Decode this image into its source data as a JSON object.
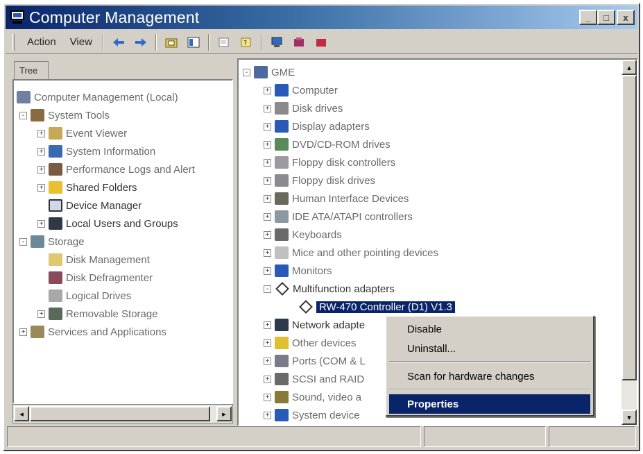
{
  "window": {
    "title": "Computer Management"
  },
  "title_buttons": {
    "minimize": "_",
    "maximize": "□",
    "close": "x"
  },
  "toolbar": {
    "menus": [
      "Action",
      "View"
    ],
    "icons": [
      "back-arrow-icon",
      "forward-arrow-icon",
      "up-folder-icon",
      "show-tree-icon",
      "properties-icon",
      "help-icon",
      "computer-icon",
      "scan-icon",
      "uninstall-icon"
    ]
  },
  "left_pane": {
    "tab_label": "Tree",
    "nodes": [
      {
        "label": "Computer Management (Local)",
        "level": 0,
        "expander": "",
        "dim": true
      },
      {
        "label": "System Tools",
        "level": 1,
        "expander": "-",
        "dim": true
      },
      {
        "label": "Event Viewer",
        "level": 2,
        "expander": "+",
        "dim": true
      },
      {
        "label": "System Information",
        "level": 2,
        "expander": "+",
        "dim": true
      },
      {
        "label": "Performance Logs and Alert",
        "level": 2,
        "expander": "+",
        "dim": true
      },
      {
        "label": "Shared Folders",
        "level": 2,
        "expander": "+",
        "dim": false
      },
      {
        "label": "Device Manager",
        "level": 2,
        "expander": "",
        "dim": false
      },
      {
        "label": "Local Users and Groups",
        "level": 2,
        "expander": "+",
        "dim": false
      },
      {
        "label": "Storage",
        "level": 1,
        "expander": "-",
        "dim": true
      },
      {
        "label": "Disk Management",
        "level": 2,
        "expander": "",
        "dim": true
      },
      {
        "label": "Disk Defragmenter",
        "level": 2,
        "expander": "",
        "dim": true
      },
      {
        "label": "Logical Drives",
        "level": 2,
        "expander": "",
        "dim": true
      },
      {
        "label": "Removable Storage",
        "level": 2,
        "expander": "+",
        "dim": true
      },
      {
        "label": "Services and Applications",
        "level": 1,
        "expander": "+",
        "dim": true
      }
    ]
  },
  "right_pane": {
    "root": "GME",
    "devices": [
      {
        "label": "Computer",
        "expander": "+",
        "dim": true
      },
      {
        "label": "Disk drives",
        "expander": "+",
        "dim": true
      },
      {
        "label": "Display adapters",
        "expander": "+",
        "dim": true
      },
      {
        "label": "DVD/CD-ROM drives",
        "expander": "+",
        "dim": true
      },
      {
        "label": "Floppy disk controllers",
        "expander": "+",
        "dim": true
      },
      {
        "label": "Floppy disk drives",
        "expander": "+",
        "dim": true
      },
      {
        "label": "Human Interface Devices",
        "expander": "+",
        "dim": true
      },
      {
        "label": "IDE ATA/ATAPI controllers",
        "expander": "+",
        "dim": true
      },
      {
        "label": "Keyboards",
        "expander": "+",
        "dim": true
      },
      {
        "label": "Mice and other pointing devices",
        "expander": "+",
        "dim": true
      },
      {
        "label": "Monitors",
        "expander": "+",
        "dim": true
      },
      {
        "label": "Multifunction adapters",
        "expander": "-",
        "dim": false
      },
      {
        "label": "Network adapte",
        "expander": "+",
        "dim": false
      },
      {
        "label": "Other devices",
        "expander": "+",
        "dim": true
      },
      {
        "label": "Ports (COM & L",
        "expander": "+",
        "dim": true
      },
      {
        "label": "SCSI and RAID",
        "expander": "+",
        "dim": true
      },
      {
        "label": "Sound, video a",
        "expander": "+",
        "dim": true
      },
      {
        "label": "System device",
        "expander": "+",
        "dim": true
      }
    ],
    "selected_child": "RW-470 Controller (D1) V1.3"
  },
  "context_menu": {
    "disable": "Disable",
    "uninstall": "Uninstall...",
    "scan": "Scan for hardware changes",
    "properties": "Properties"
  },
  "colors": {
    "selection": "#0a246a",
    "title_start": "#0a246a",
    "title_end": "#a6caf0",
    "face": "#d4d0c8"
  }
}
